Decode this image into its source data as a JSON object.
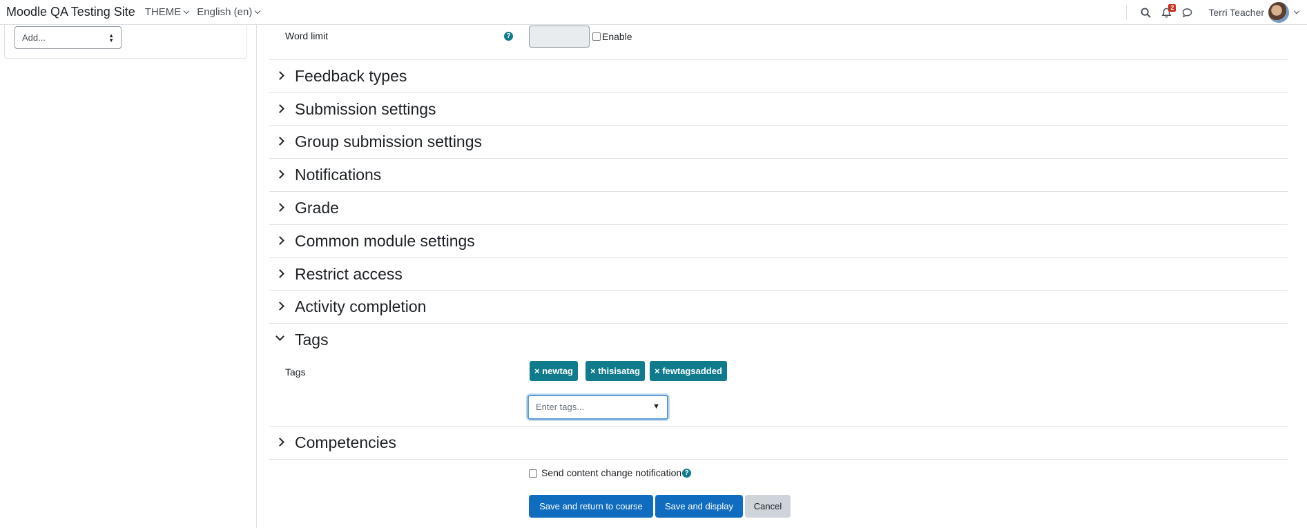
{
  "navbar": {
    "brand": "Moodle QA Testing Site",
    "menus": [
      "THEME",
      "English (en)"
    ],
    "notification_count": "2",
    "username": "Terri Teacher"
  },
  "drawer": {
    "add_select": "Add..."
  },
  "form": {
    "word_limit_label": "Word limit",
    "enable_label": "Enable",
    "sections": [
      {
        "title": "Feedback types",
        "expanded": false
      },
      {
        "title": "Submission settings",
        "expanded": false
      },
      {
        "title": "Group submission settings",
        "expanded": false
      },
      {
        "title": "Notifications",
        "expanded": false
      },
      {
        "title": "Grade",
        "expanded": false
      },
      {
        "title": "Common module settings",
        "expanded": false
      },
      {
        "title": "Restrict access",
        "expanded": false
      },
      {
        "title": "Activity completion",
        "expanded": false
      },
      {
        "title": "Tags",
        "expanded": true
      },
      {
        "title": "Competencies",
        "expanded": false
      }
    ],
    "tags_label": "Tags",
    "tags": [
      "× newtag",
      "× thisisatag",
      "× fewtagsadded"
    ],
    "tags_placeholder": "Enter tags...",
    "send_notification_label": "Send content change notification",
    "buttons": {
      "save_return": "Save and return to course",
      "save_display": "Save and display",
      "cancel": "Cancel"
    }
  },
  "colors": {
    "primary": "#0f6cbf",
    "tag": "#0f7b8c",
    "secondary": "#ced4da"
  },
  "icons": {
    "help": "help-icon",
    "search": "search-icon",
    "bell": "bell-icon",
    "chat": "chat-icon"
  }
}
